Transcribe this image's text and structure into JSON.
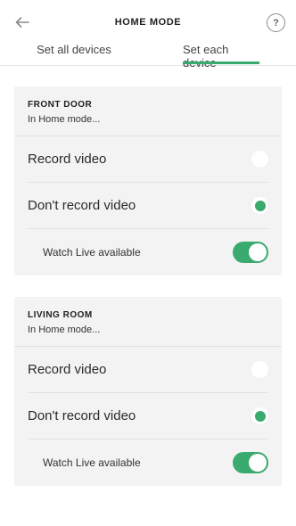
{
  "header": {
    "title": "HOME MODE",
    "help_label": "?"
  },
  "tabs": [
    {
      "label": "Set all devices",
      "active": false
    },
    {
      "label": "Set each device",
      "active": true
    }
  ],
  "accent_color": "#3aaa6e",
  "cards": [
    {
      "name": "FRONT DOOR",
      "subtitle": "In Home mode...",
      "options": [
        {
          "label": "Record video",
          "selected": false
        },
        {
          "label": "Don't record video",
          "selected": true
        }
      ],
      "watch_live": {
        "label": "Watch Live available",
        "enabled": true
      }
    },
    {
      "name": "LIVING ROOM",
      "subtitle": "In Home mode...",
      "options": [
        {
          "label": "Record video",
          "selected": false
        },
        {
          "label": "Don't record video",
          "selected": true
        }
      ],
      "watch_live": {
        "label": "Watch Live available",
        "enabled": true
      }
    }
  ]
}
